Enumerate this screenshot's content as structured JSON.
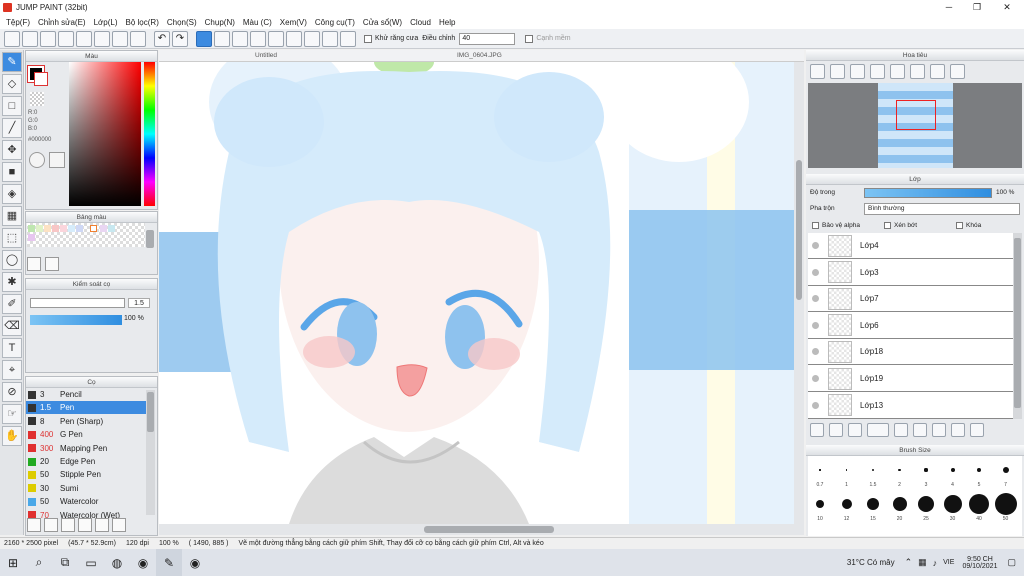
{
  "window": {
    "title": "JUMP PAINT (32bit)"
  },
  "menu": [
    "Tệp(F)",
    "Chỉnh sửa(E)",
    "Lớp(L)",
    "Bộ lọc(R)",
    "Chọn(S)",
    "Chụp(N)",
    "Màu (C)",
    "Xem(V)",
    "Công cụ(T)",
    "Cửa sổ(W)",
    "Cloud",
    "Help"
  ],
  "toolbar": {
    "antialias_label": "Khử răng cưa",
    "adjust_label": "Điều chỉnh",
    "adjust_value": "40",
    "soften_label": "Cạnh mềm"
  },
  "color_panel": {
    "title": "Màu",
    "r_label": "R:0",
    "g_label": "G:0",
    "b_label": "B:0",
    "hex": "#000000",
    "fg_color": "#000000",
    "bg_color": "#ffffff"
  },
  "swatch_panel": {
    "title": "Bảng màu"
  },
  "brush_size_panel": {
    "title": "Kiểm soát cọ",
    "size_value": "1.5",
    "opacity_value": "100 %"
  },
  "brush_panel": {
    "title": "Cọ",
    "brushes": [
      {
        "size": "3",
        "name": "Pencil",
        "color": "#333333"
      },
      {
        "size": "1.5",
        "name": "Pen",
        "color": "#333333"
      },
      {
        "size": "8",
        "name": "Pen (Sharp)",
        "color": "#333333"
      },
      {
        "size": "400",
        "name": "G Pen",
        "color": "#e03030"
      },
      {
        "size": "300",
        "name": "Mapping Pen",
        "color": "#e03030"
      },
      {
        "size": "20",
        "name": "Edge Pen",
        "color": "#22aa22"
      },
      {
        "size": "50",
        "name": "Stipple Pen",
        "color": "#ddcc00"
      },
      {
        "size": "30",
        "name": "Sumi",
        "color": "#ddcc00"
      },
      {
        "size": "50",
        "name": "Watercolor",
        "color": "#4aa8e8"
      },
      {
        "size": "70",
        "name": "Watercolor (Wet)",
        "color": "#e03030"
      }
    ]
  },
  "canvas": {
    "tab_left": "Untitled",
    "tab_right": "IMG_0604.JPG"
  },
  "navigator": {
    "title": "Hoa tiêu"
  },
  "layer_panel": {
    "title": "Lớp",
    "opacity_label": "Độ trong",
    "opacity_value": "100 %",
    "blend_label": "Pha trộn",
    "blend_value": "Bình thường",
    "protect_alpha": "Bảo vệ alpha",
    "clipping": "Xén bớt",
    "lock": "Khóa",
    "layers": [
      "Lớp4",
      "Lớp3",
      "Lớp7",
      "Lớp6",
      "Lớp18",
      "Lớp19",
      "Lớp13"
    ]
  },
  "brush_size_grid": {
    "title": "Brush Size",
    "labels": [
      "0.7",
      "1",
      "1.5",
      "2",
      "3",
      "4",
      "5",
      "7",
      "10",
      "12",
      "15",
      "20",
      "25",
      "30",
      "40",
      "50"
    ]
  },
  "status": {
    "dims": "2160 * 2500 pixel",
    "physical": "(45.7 * 52.9cm)",
    "dpi": "120 dpi",
    "zoom": "100 %",
    "coords": "( 1490, 885 )",
    "hint": "Vẽ một đường thẳng bằng cách giữ phím Shift, Thay đổi cỡ cọ bằng cách giữ phím Ctrl, Alt và kéo"
  },
  "taskbar": {
    "weather": "31°C Có mây",
    "lang": "VIE",
    "time": "9:50 CH",
    "date": "09/10/2021"
  }
}
